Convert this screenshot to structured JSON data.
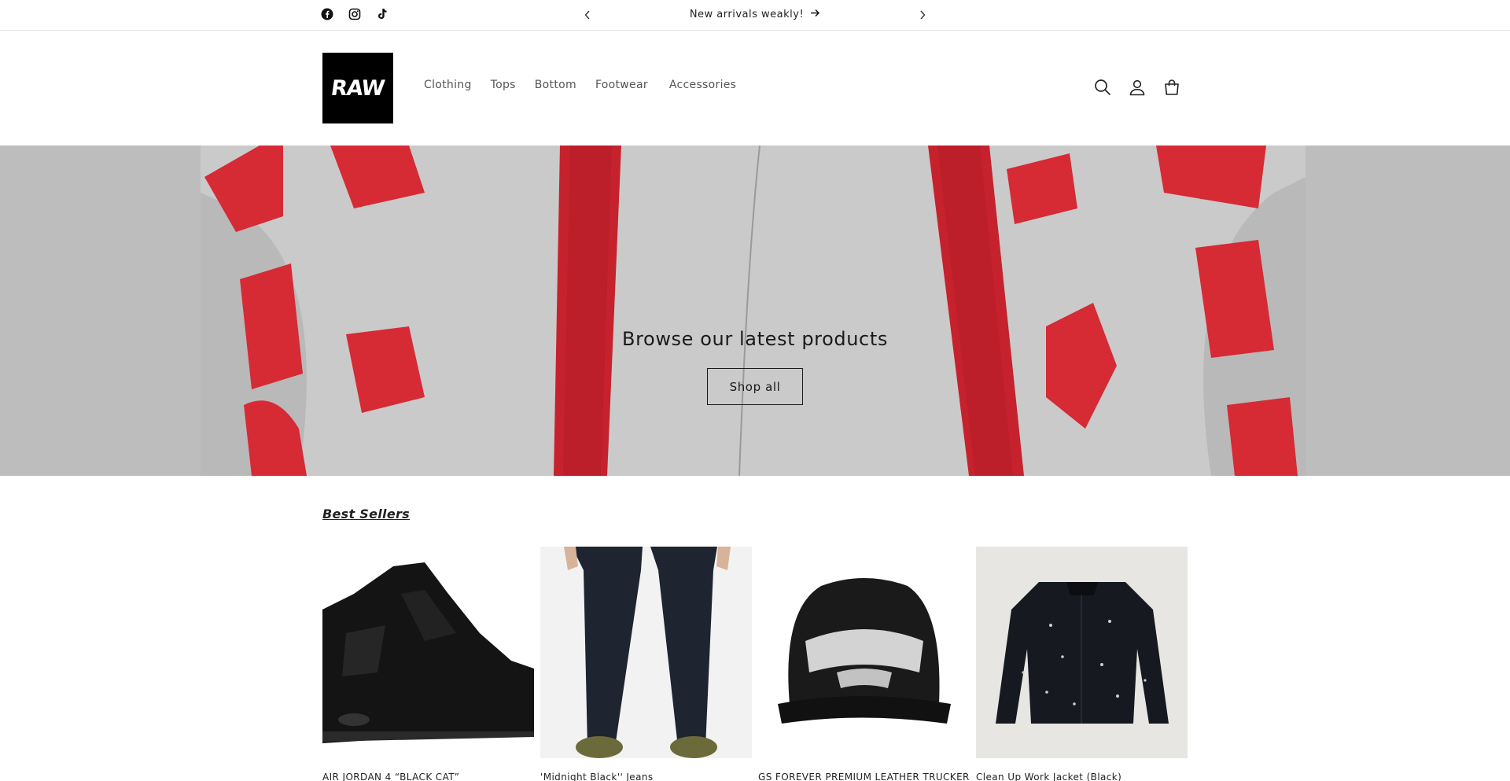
{
  "announcement": {
    "message": "New arrivals weakly!",
    "social_icons": [
      "facebook-icon",
      "instagram-icon",
      "tiktok-icon"
    ]
  },
  "header": {
    "logo_text": "RAW",
    "nav": [
      {
        "label": "Clothing"
      },
      {
        "label": "Tops"
      },
      {
        "label": "Bottom"
      },
      {
        "label": "Footwear"
      },
      {
        "label": "Accessories"
      }
    ],
    "icons": [
      "search-icon",
      "account-icon",
      "cart-icon"
    ]
  },
  "hero": {
    "title": "Browse our latest products",
    "button_label": "Shop all"
  },
  "best_sellers": {
    "title": "Best Sellers",
    "products": [
      {
        "title": "AIR JORDAN 4 “BLACK CAT”"
      },
      {
        "title": "'Midnight Black'' Jeans"
      },
      {
        "title": "GS FOREVER PREMIUM LEATHER TRUCKER"
      },
      {
        "title": "Clean Up Work Jacket (Black)"
      }
    ]
  },
  "colors": {
    "accent_red": "#d62a35",
    "hero_gray": "#bdbdbd",
    "text": "#121212"
  }
}
